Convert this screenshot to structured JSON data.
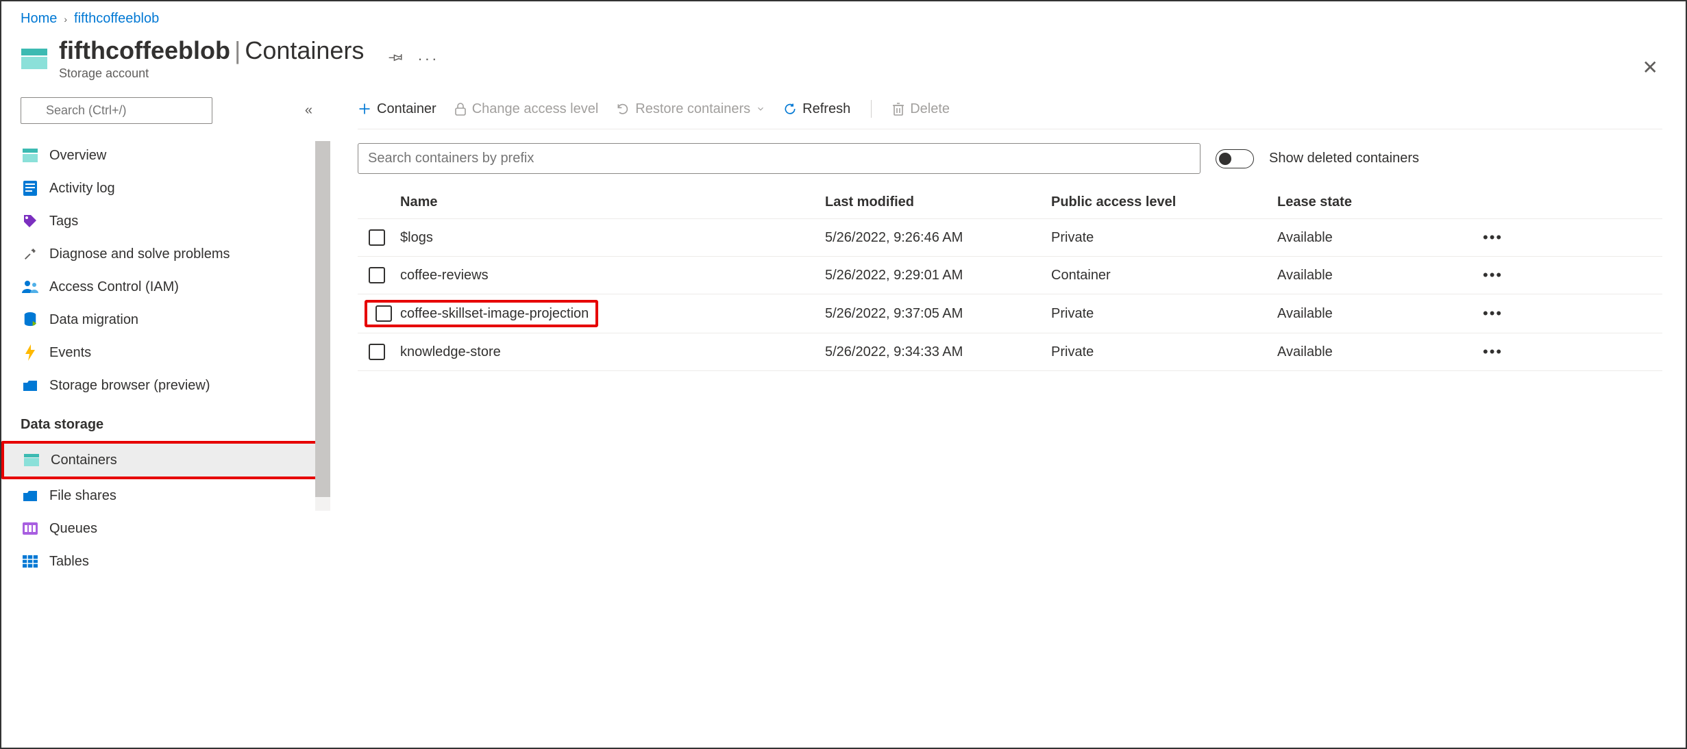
{
  "breadcrumb": {
    "home": "Home",
    "current": "fifthcoffeeblob"
  },
  "page_title": {
    "name": "fifthcoffeeblob",
    "section": "Containers",
    "subtype": "Storage account"
  },
  "search": {
    "placeholder": "Search (Ctrl+/)"
  },
  "sidebar": {
    "items": [
      {
        "label": "Overview"
      },
      {
        "label": "Activity log"
      },
      {
        "label": "Tags"
      },
      {
        "label": "Diagnose and solve problems"
      },
      {
        "label": "Access Control (IAM)"
      },
      {
        "label": "Data migration"
      },
      {
        "label": "Events"
      },
      {
        "label": "Storage browser (preview)"
      }
    ],
    "heading1": "Data storage",
    "storage_items": [
      {
        "label": "Containers"
      },
      {
        "label": "File shares"
      },
      {
        "label": "Queues"
      },
      {
        "label": "Tables"
      }
    ]
  },
  "toolbar": {
    "container": "Container",
    "change_access": "Change access level",
    "restore": "Restore containers",
    "refresh": "Refresh",
    "delete": "Delete"
  },
  "filter": {
    "placeholder": "Search containers by prefix",
    "toggle_label": "Show deleted containers"
  },
  "table": {
    "headers": {
      "name": "Name",
      "modified": "Last modified",
      "access": "Public access level",
      "lease": "Lease state"
    },
    "rows": [
      {
        "name": "$logs",
        "modified": "5/26/2022, 9:26:46 AM",
        "access": "Private",
        "lease": "Available"
      },
      {
        "name": "coffee-reviews",
        "modified": "5/26/2022, 9:29:01 AM",
        "access": "Container",
        "lease": "Available"
      },
      {
        "name": "coffee-skillset-image-projection",
        "modified": "5/26/2022, 9:37:05 AM",
        "access": "Private",
        "lease": "Available"
      },
      {
        "name": "knowledge-store",
        "modified": "5/26/2022, 9:34:33 AM",
        "access": "Private",
        "lease": "Available"
      }
    ]
  }
}
